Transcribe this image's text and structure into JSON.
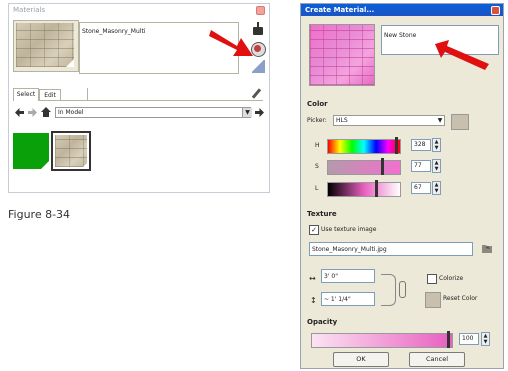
{
  "materials_panel": {
    "title": "Materials",
    "material_name": "Stone_Masonry_Multi",
    "tabs": [
      {
        "label": "Select"
      },
      {
        "label": "Edit"
      }
    ],
    "library_value": "In Model",
    "swatch_colors": {
      "green": "#0aa00a"
    }
  },
  "caption": "Figure 8-34",
  "create_dialog": {
    "title": "Create Material...",
    "name_value": "New Stone",
    "color_heading": "Color",
    "picker_label": "Picker:",
    "picker_value": "HLS",
    "h_label": "H",
    "h_value": "328",
    "s_label": "S",
    "s_value": "77",
    "l_label": "L",
    "l_value": "67",
    "texture_heading": "Texture",
    "use_texture_label": "Use texture image",
    "texture_file": "Stone_Masonry_Multi.jpg",
    "width_value": "3' 0\"",
    "height_value": "~ 1' 1/4\"",
    "colorize_label": "Colorize",
    "reset_color_label": "Reset Color",
    "opacity_heading": "Opacity",
    "opacity_value": "100",
    "ok_label": "OK",
    "cancel_label": "Cancel",
    "accent_pink": "#e85fbf",
    "arrow_color": "#e01010"
  }
}
